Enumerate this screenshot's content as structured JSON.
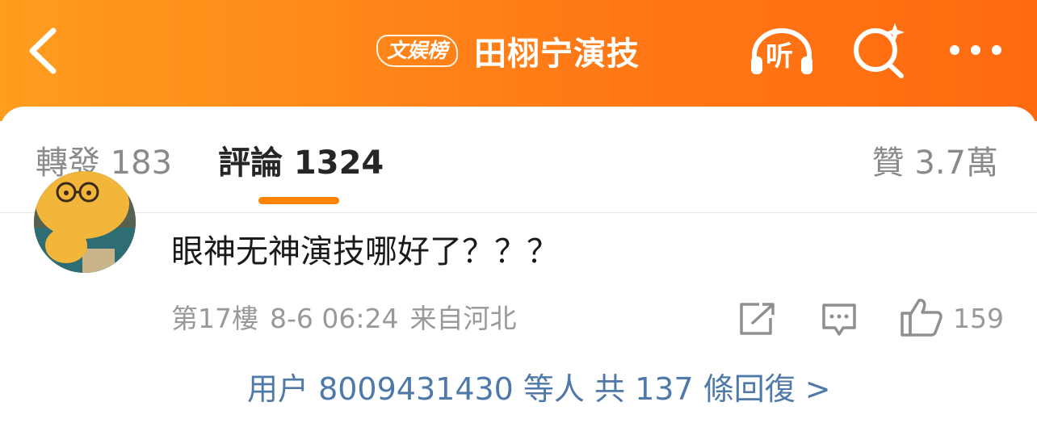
{
  "header": {
    "badge": "文娱榜",
    "title": "田栩宁演技",
    "listen_label": "听",
    "icons": [
      "back-icon",
      "headphones-icon",
      "search-sparkle-icon",
      "more-icon"
    ],
    "colors": {
      "gradient_start": "#ff9d1e",
      "gradient_end": "#ff6a10"
    }
  },
  "tabs": {
    "repost": "轉發 183",
    "comments": "評論 1324",
    "likes": "贊 3.7萬",
    "active": "comments",
    "indicator_color": "#ff8200"
  },
  "comment": {
    "text": "眼神无神演技哪好了？？？",
    "floor": "第17樓",
    "date": "8-6 06:24",
    "location": "来自河北",
    "like_count": "159"
  },
  "replies_link": "用户 8009431430 等人 共 137 條回復 >"
}
